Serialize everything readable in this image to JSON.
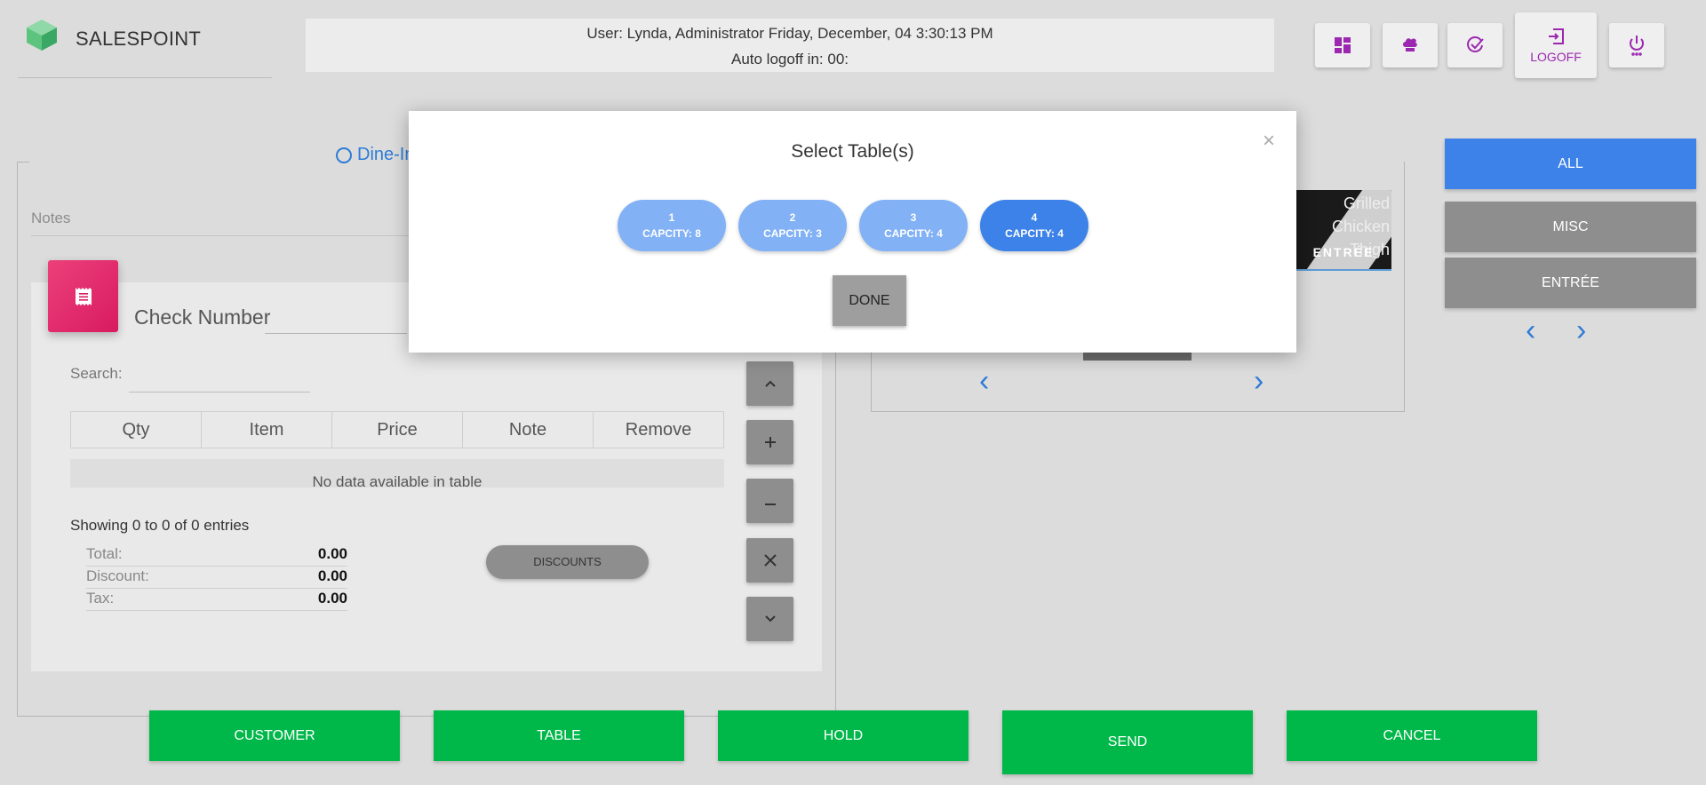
{
  "app": {
    "brand": "SALESPOINT"
  },
  "header": {
    "user_line": "User: Lynda, Administrator Friday, December, 04 3:30:13 PM",
    "logoff_line": "Auto logoff in: 00:",
    "buttons": {
      "logoff_label": "LOGOFF"
    }
  },
  "order": {
    "dine_in_label": "Dine-In",
    "notes_label": "Notes",
    "check_number_label": "Check Number",
    "search_label": "Search:",
    "search_value": "",
    "columns": [
      "Qty",
      "Item",
      "Price",
      "Note",
      "Remove"
    ],
    "empty_text": "No data available in table",
    "showing_text": "Showing 0 to 0 of 0 entries",
    "totals": {
      "total_label": "Total:",
      "total_value": "0.00",
      "discount_label": "Discount:",
      "discount_value": "0.00",
      "tax_label": "Tax:",
      "tax_value": "0.00"
    },
    "discounts_label": "DISCOUNTS"
  },
  "menu_item": {
    "name": "Grilled Chicken Thigh",
    "category": "ENTRÉE"
  },
  "categories": [
    {
      "label": "ALL",
      "color": "#3d82e8"
    },
    {
      "label": "MISC",
      "color": "#8e8e8e"
    },
    {
      "label": "ENTRÉE",
      "color": "#8e8e8e"
    }
  ],
  "bottom_buttons": {
    "customer": "CUSTOMER",
    "table": "TABLE",
    "hold": "HOLD",
    "send": "SEND",
    "cancel": "CANCEL"
  },
  "modal": {
    "title": "Select Table(s)",
    "close": "×",
    "tables": [
      {
        "number": "1",
        "capacity": "CAPCITY: 8",
        "selected": false
      },
      {
        "number": "2",
        "capacity": "CAPCITY: 3",
        "selected": false
      },
      {
        "number": "3",
        "capacity": "CAPCITY: 4",
        "selected": false
      },
      {
        "number": "4",
        "capacity": "CAPCITY: 4",
        "selected": true
      }
    ],
    "done_label": "DONE"
  },
  "colors": {
    "accent": "#3d82e8",
    "green": "#00b84a",
    "purple": "#9c27b0",
    "pink": "#d81b60"
  }
}
